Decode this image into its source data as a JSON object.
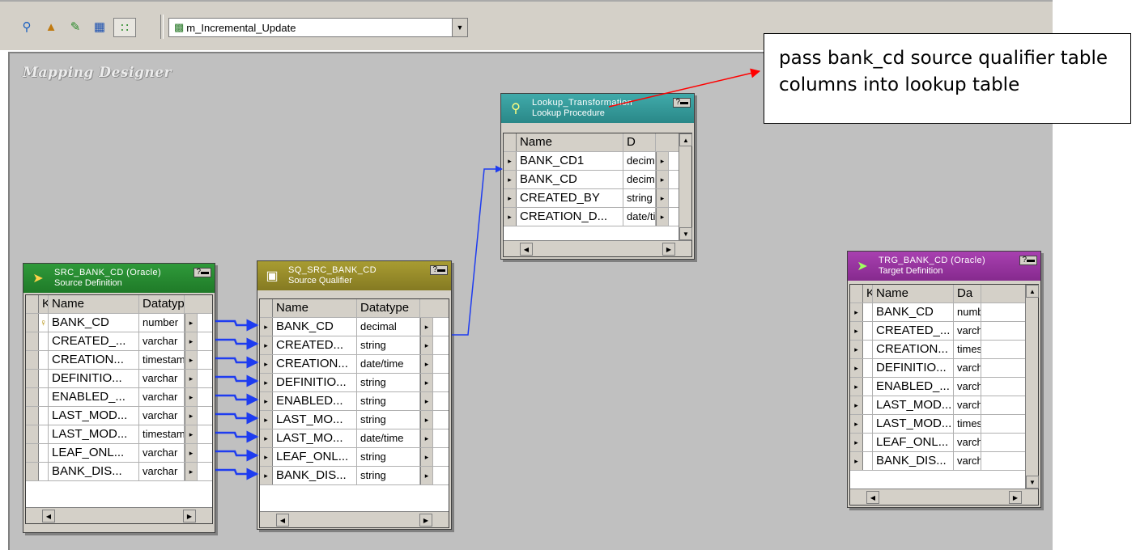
{
  "toolbar": {
    "icons": [
      "search-icon",
      "arrange-icon",
      "edit-icon",
      "table-icon",
      "link-icon"
    ],
    "mapping_name": "m_Incremental_Update"
  },
  "canvas": {
    "title": "Mapping Designer"
  },
  "callout": {
    "text": "pass bank_cd source qualifier table columns into lookup table"
  },
  "colors": {
    "src_header": "#2f9a3a",
    "sq_header": "#9a8f2c",
    "lookup_header": "#3aa3a3",
    "target_header": "#9a3aa0",
    "link": "#1e3cf0",
    "callout_arrow": "#ff0000"
  },
  "nodes": {
    "source": {
      "name": "SRC_BANK_CD (Oracle)",
      "subtitle": "Source Definition",
      "columns": {
        "key": "K",
        "name": "Name",
        "type": "Datatype"
      },
      "rows": [
        {
          "key": "♀",
          "name": "BANK_CD",
          "type": "number"
        },
        {
          "key": "",
          "name": "CREATED_...",
          "type": "varchar"
        },
        {
          "key": "",
          "name": "CREATION...",
          "type": "timestamp"
        },
        {
          "key": "",
          "name": "DEFINITIO...",
          "type": "varchar"
        },
        {
          "key": "",
          "name": "ENABLED_...",
          "type": "varchar"
        },
        {
          "key": "",
          "name": "LAST_MOD...",
          "type": "varchar"
        },
        {
          "key": "",
          "name": "LAST_MOD...",
          "type": "timestamp"
        },
        {
          "key": "",
          "name": "LEAF_ONL...",
          "type": "varchar"
        },
        {
          "key": "",
          "name": "BANK_DIS...",
          "type": "varchar"
        }
      ]
    },
    "qualifier": {
      "name": "SQ_SRC_BANK_CD",
      "subtitle": "Source Qualifier",
      "columns": {
        "name": "Name",
        "type": "Datatype"
      },
      "rows": [
        {
          "name": "BANK_CD",
          "type": "decimal"
        },
        {
          "name": "CREATED...",
          "type": "string"
        },
        {
          "name": "CREATION...",
          "type": "date/time"
        },
        {
          "name": "DEFINITIO...",
          "type": "string"
        },
        {
          "name": "ENABLED...",
          "type": "string"
        },
        {
          "name": "LAST_MO...",
          "type": "string"
        },
        {
          "name": "LAST_MO...",
          "type": "date/time"
        },
        {
          "name": "LEAF_ONL...",
          "type": "string"
        },
        {
          "name": "BANK_DIS...",
          "type": "string"
        }
      ]
    },
    "lookup": {
      "name": "Lookup_Transformation",
      "subtitle": "Lookup Procedure",
      "columns": {
        "name": "Name",
        "type": "D"
      },
      "rows": [
        {
          "name": "BANK_CD1",
          "type": "decimal"
        },
        {
          "name": "BANK_CD",
          "type": "decimal"
        },
        {
          "name": "CREATED_BY",
          "type": "string"
        },
        {
          "name": "CREATION_D...",
          "type": "date/time"
        }
      ]
    },
    "target": {
      "name": "TRG_BANK_CD (Oracle)",
      "subtitle": "Target Definition",
      "columns": {
        "key": "K",
        "name": "Name",
        "type": "Da"
      },
      "rows": [
        {
          "name": "BANK_CD",
          "type": "number"
        },
        {
          "name": "CREATED_...",
          "type": "varchar"
        },
        {
          "name": "CREATION...",
          "type": "timestamp"
        },
        {
          "name": "DEFINITIO...",
          "type": "varchar"
        },
        {
          "name": "ENABLED_...",
          "type": "varchar"
        },
        {
          "name": "LAST_MOD...",
          "type": "varchar"
        },
        {
          "name": "LAST_MOD...",
          "type": "timestamp"
        },
        {
          "name": "LEAF_ONL...",
          "type": "varchar"
        },
        {
          "name": "BANK_DIS...",
          "type": "varchar"
        }
      ]
    }
  }
}
